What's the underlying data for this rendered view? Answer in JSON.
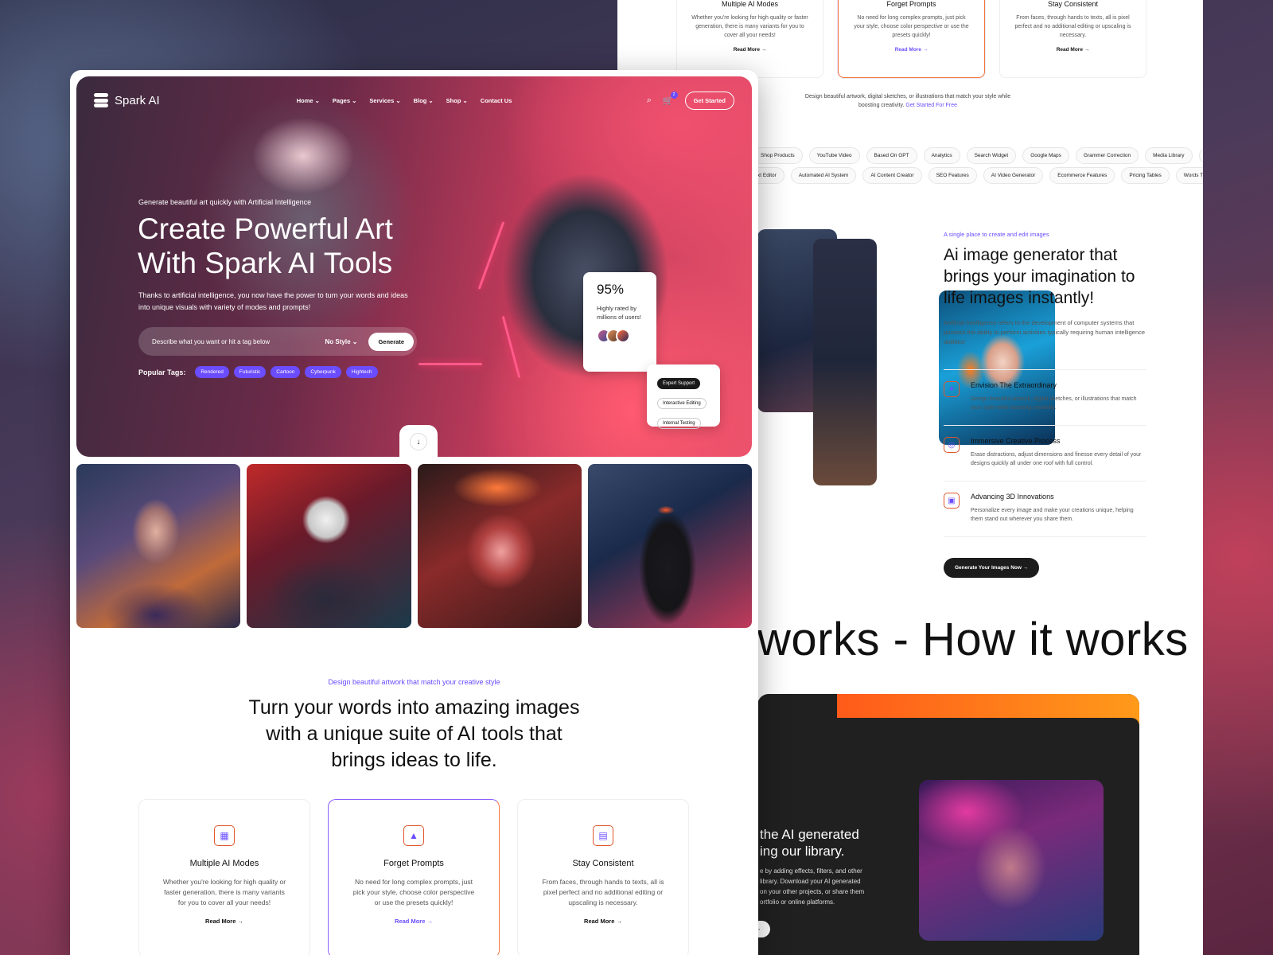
{
  "back": {
    "cards": [
      {
        "title": "Multiple AI Modes",
        "desc": "Whether you're looking for high quality or faster generation, there is many variants for you to cover all your needs!",
        "link": "Read More →"
      },
      {
        "title": "Forget Prompts",
        "desc": "No need for long complex prompts, just pick your style, choose color perspective or use the presets quickly!",
        "link": "Read More →"
      },
      {
        "title": "Stay Consistent",
        "desc": "From faces, through hands to texts, all is pixel perfect and no additional editing or upscaling is necessary.",
        "link": "Read More →"
      }
    ],
    "note_text": "Design beautiful artwork, digital sketches, or illustrations that match your style while boosting creativity.",
    "note_link": "Get Started For Free",
    "tags_row1": [
      "Shop Products",
      "YouTube Video",
      "Based On GPT",
      "Analytics",
      "Search Widget",
      "Google Maps",
      "Grammer Correction",
      "Media Library",
      "Te"
    ],
    "tags_row2": [
      "xt Editor",
      "Automated AI System",
      "AI Content Creator",
      "SEO Features",
      "AI Video Generator",
      "Ecommerce Features",
      "Pricing Tables",
      "Words T"
    ],
    "feature": {
      "eyebrow": "A single place to create and edit images",
      "title": "Ai image generator that brings your imagination to life images instantly!",
      "desc": "Artificial Intelligence refers to the development of computer systems that possess the ability to perform activities typically requiring human intelligence abilities!",
      "items": [
        {
          "title": "Envision The Extraordinary",
          "desc": "Design beautiful artwork, digital sketches, or illustrations that match your style while boosting creativity."
        },
        {
          "title": "Immersive Creative Process",
          "desc": "Erase distractions, adjust dimensions and finesse every detail of your designs quickly all under one roof with full control."
        },
        {
          "title": "Advancing 3D Innovations",
          "desc": "Personalize every image and make your creations unique, helping them stand out wherever you share them."
        }
      ],
      "cta": "Generate Your Images Now →"
    },
    "marquee": "works - How it works",
    "dark": {
      "title_l1": "the AI generated",
      "title_l2": "ing our library.",
      "desc_l1": "e by adding effects, filters, and other",
      "desc_l2": "library. Download your AI generated",
      "desc_l3": "on your other projects, or share them",
      "desc_l4": "ortfolio or online platforms.",
      "btn": "es →"
    }
  },
  "front": {
    "brand": "Spark AI",
    "menu": [
      "Home ⌄",
      "Pages ⌄",
      "Services ⌄",
      "Blog ⌄",
      "Shop ⌄",
      "Contact Us"
    ],
    "cart_count": "2",
    "get_started": "Get Started",
    "hero": {
      "sub": "Generate beautiful art quickly with Artificial Intelligence",
      "title": "Create Powerful Art With Spark AI Tools",
      "desc": "Thanks to artificial intelligence, you now have the power to turn your words and ideas into unique visuals with variety of modes and prompts!",
      "search_placeholder": "Describe what you want or hit a tag below",
      "style": "No Style ⌄",
      "generate": "Generate",
      "tags_label": "Popular Tags:",
      "tags": [
        "Rendered",
        "Futuristic",
        "Cartoon",
        "Cyberpunk",
        "Hightech"
      ]
    },
    "stat": {
      "value": "95%",
      "label": "Highly rated by millions of users!"
    },
    "chips": [
      "Expert Support",
      "Interactive Editing",
      "Internal Testing"
    ],
    "section": {
      "eyebrow": "Design beautiful artwork that match your creative style",
      "title": "Turn your words into amazing images with a unique suite of AI tools that brings ideas to life."
    },
    "cards": [
      {
        "title": "Multiple AI Modes",
        "desc": "Whether you're looking for high quality or faster generation, there is many variants for you to cover all your needs!",
        "link": "Read More →"
      },
      {
        "title": "Forget Prompts",
        "desc": "No need for long complex prompts, just pick your style, choose color perspective or use the presets quickly!",
        "link": "Read More →"
      },
      {
        "title": "Stay Consistent",
        "desc": "From faces, through hands to texts, all is pixel perfect and no additional editing or upscaling is necessary.",
        "link": "Read More →"
      }
    ]
  },
  "colors": {
    "accent": "#6b4cff",
    "orange": "#f2763a",
    "dark": "#1c1c1c"
  }
}
